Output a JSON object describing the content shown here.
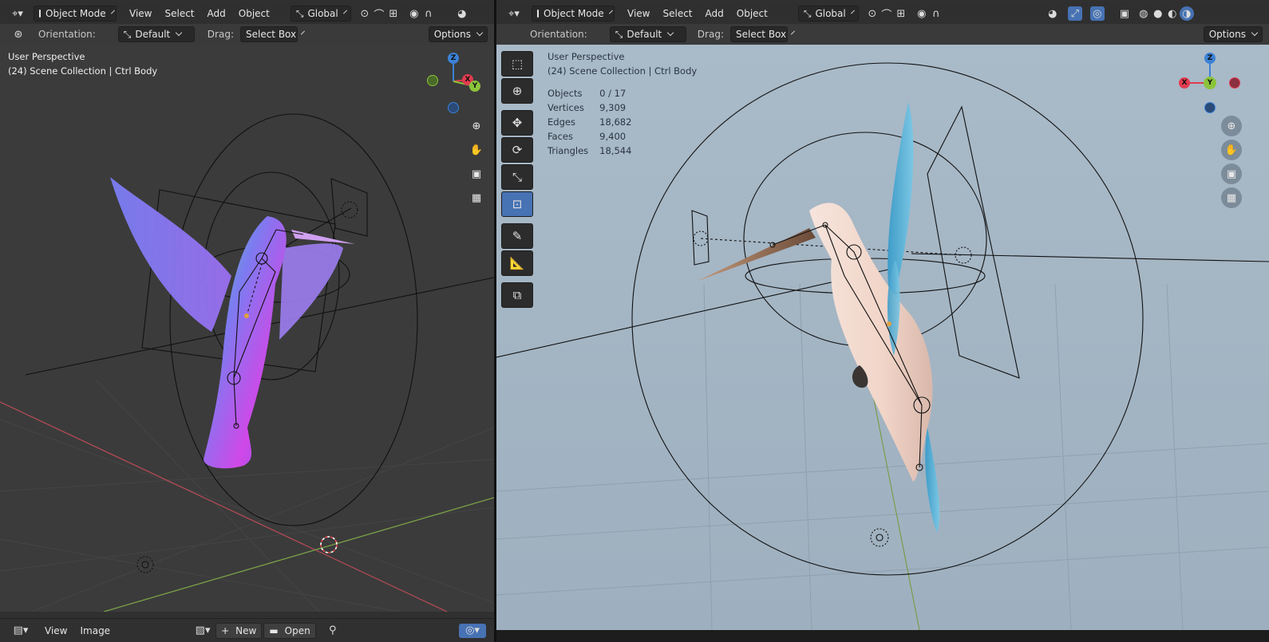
{
  "left": {
    "header": {
      "editor_icon": "editor-type-icon",
      "mode": "Object Mode",
      "menus": [
        "View",
        "Select",
        "Add",
        "Object"
      ],
      "transform_space": "Global"
    },
    "tool_settings": {
      "orientation_label": "Orientation:",
      "orientation_value": "Default",
      "drag_label": "Drag:",
      "drag_value": "Select Box",
      "options": "Options"
    },
    "overlay": {
      "perspective": "User Perspective",
      "collection": "(24) Scene Collection | Ctrl Body"
    },
    "gizmo": {
      "z": "Z",
      "x": "X",
      "y": "Y"
    }
  },
  "right": {
    "header": {
      "mode": "Object Mode",
      "menus": [
        "View",
        "Select",
        "Add",
        "Object"
      ],
      "transform_space": "Global"
    },
    "tool_settings": {
      "orientation_label": "Orientation:",
      "orientation_value": "Default",
      "drag_label": "Drag:",
      "drag_value": "Select Box",
      "options": "Options"
    },
    "overlay": {
      "perspective": "User Perspective",
      "collection": "(24) Scene Collection | Ctrl Body"
    },
    "stats": [
      {
        "label": "Objects",
        "value": "0 / 17"
      },
      {
        "label": "Vertices",
        "value": "9,309"
      },
      {
        "label": "Edges",
        "value": "18,682"
      },
      {
        "label": "Faces",
        "value": "9,400"
      },
      {
        "label": "Triangles",
        "value": "18,544"
      }
    ],
    "gizmo": {
      "z": "Z",
      "x": "X",
      "y": "Y"
    }
  },
  "bottom": {
    "menus": [
      "View",
      "Image"
    ],
    "new_label": "New",
    "open_label": "Open"
  },
  "colors": {
    "accent": "#4772b3",
    "axis_x": "#e23b4f",
    "axis_y": "#8bc43b",
    "axis_z": "#3b82d6"
  }
}
